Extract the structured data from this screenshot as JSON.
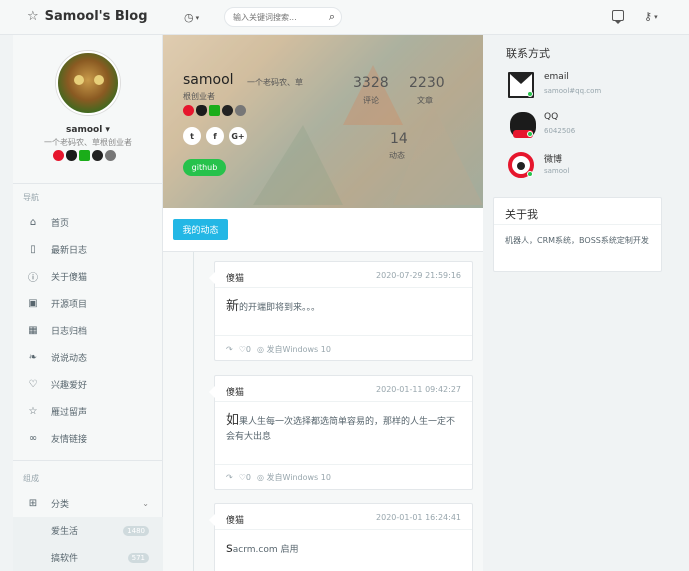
{
  "header": {
    "title": "Samool's Blog",
    "search_placeholder": "输入关键词搜索..."
  },
  "sidebar": {
    "username": "samool",
    "signature": "一个老码农、草根创业者",
    "nav_heading": "导航",
    "nav_items": [
      {
        "label": "首页",
        "icon": "home-icon"
      },
      {
        "label": "最新日志",
        "icon": "book-icon"
      },
      {
        "label": "关于傻猫",
        "icon": "info-icon"
      },
      {
        "label": "开源项目",
        "icon": "gift-icon"
      },
      {
        "label": "日志归档",
        "icon": "calendar-icon"
      },
      {
        "label": "说说动态",
        "icon": "twitter-icon"
      },
      {
        "label": "兴趣爱好",
        "icon": "heart-icon"
      },
      {
        "label": "雁过留声",
        "icon": "star-icon"
      },
      {
        "label": "友情链接",
        "icon": "link-icon"
      }
    ],
    "group_heading": "组成",
    "category_label": "分类",
    "sub_items": [
      {
        "label": "爱生活",
        "count": "1480"
      },
      {
        "label": "搞软件",
        "count": "571"
      }
    ]
  },
  "banner": {
    "name": "samool",
    "signature": "一个老码农、草",
    "role": "根创业者",
    "stats": [
      {
        "num": "3328",
        "label": "评论"
      },
      {
        "num": "2230",
        "label": "文章"
      },
      {
        "num": "14",
        "label": "动态"
      }
    ],
    "github_label": "github"
  },
  "tabs": {
    "active": "我的动态"
  },
  "posts": [
    {
      "author": "傻猫",
      "time": "2020-07-29 21:59:16",
      "first": "新",
      "rest": "的开端即将到来。。。",
      "likes": "0",
      "source": "发自Windows 10"
    },
    {
      "author": "傻猫",
      "time": "2020-01-11 09:42:27",
      "first": "如",
      "rest": "果人生每一次选择都选简单容易的，那样的人生一定不会有大出息",
      "likes": "0",
      "source": "发自Windows 10"
    },
    {
      "author": "傻猫",
      "time": "2020-01-01 16:24:41",
      "first": "s",
      "rest": "acrm.com 启用",
      "likes": "",
      "source": ""
    }
  ],
  "contact": {
    "title": "联系方式",
    "items": [
      {
        "label": "email",
        "value": "samool#qq.com"
      },
      {
        "label": "QQ",
        "value": "6042506"
      },
      {
        "label": "微博",
        "value": "samool"
      }
    ]
  },
  "about": {
    "title": "关于我",
    "text": "机器人，CRM系统，BOSS系统定制开发"
  },
  "colors": {
    "accent": "#23b7e5",
    "success": "#27c24c",
    "weibo": "#e6162d"
  }
}
